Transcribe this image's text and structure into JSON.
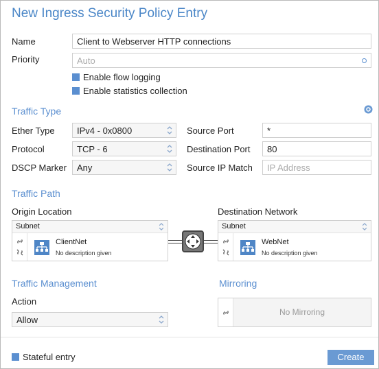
{
  "dialog": {
    "title": "New Ingress Security Policy Entry"
  },
  "fields": {
    "name_label": "Name",
    "name_value": "Client to Webserver HTTP connections",
    "priority_label": "Priority",
    "priority_placeholder": "Auto",
    "flow_logging_label": "Enable flow logging",
    "stats_label": "Enable statistics collection"
  },
  "traffic_type": {
    "heading": "Traffic Type",
    "ether_type_label": "Ether Type",
    "ether_type_value": "IPv4 - 0x0800",
    "protocol_label": "Protocol",
    "protocol_value": "TCP - 6",
    "dscp_label": "DSCP Marker",
    "dscp_value": "Any",
    "source_port_label": "Source Port",
    "source_port_value": "*",
    "dest_port_label": "Destination Port",
    "dest_port_value": "80",
    "source_ip_label": "Source IP Match",
    "source_ip_placeholder": "IP Address"
  },
  "traffic_path": {
    "heading": "Traffic Path",
    "origin_label": "Origin Location",
    "origin_type": "Subnet",
    "origin_name": "ClientNet",
    "origin_desc": "No description given",
    "dest_label": "Destination Network",
    "dest_type": "Subnet",
    "dest_name": "WebNet",
    "dest_desc": "No description given"
  },
  "traffic_management": {
    "heading": "Traffic Management",
    "action_label": "Action",
    "action_value": "Allow"
  },
  "mirroring": {
    "heading": "Mirroring",
    "empty_text": "No Mirroring"
  },
  "footer": {
    "stateful_label": "Stateful entry",
    "create_label": "Create"
  },
  "colors": {
    "accent": "#5b8fd0",
    "title": "#4a86c7",
    "button": "#6a9ad3"
  }
}
